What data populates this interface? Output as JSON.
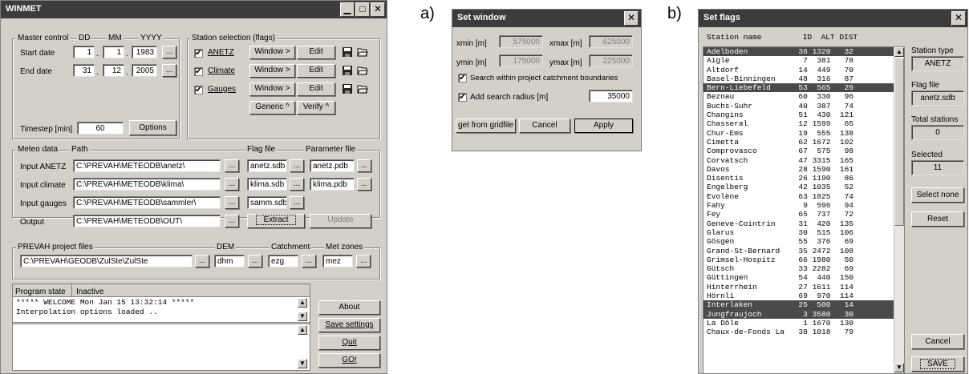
{
  "winmet": {
    "title": "WINMET",
    "master": {
      "group_label": "Master control",
      "dd": "DD",
      "mm": "MM",
      "yyyy": "YYYY",
      "start_label": "Start date",
      "start_dd": "1",
      "start_mm": "1",
      "start_yyyy": "1983",
      "end_label": "End date",
      "end_dd": "31",
      "end_mm": "12",
      "end_yyyy": "2005",
      "timestep_label": "Timestep [min]",
      "timestep": "60",
      "options": "Options",
      "dot": ".",
      "dots": "..."
    },
    "stations": {
      "group_label": "Station selection (flags)",
      "rows": [
        {
          "check": "✔",
          "label": "ANETZ",
          "window": "Window >",
          "edit": "Edit"
        },
        {
          "check": "✔",
          "label": "Climate",
          "window": "Window >",
          "edit": "Edit"
        },
        {
          "check": "✔",
          "label": "Gauges",
          "window": "Window >",
          "edit": "Edit"
        }
      ],
      "generic": "Generic ^",
      "verify": "Verify ^"
    },
    "meteo": {
      "group_label": "Meteo data",
      "path_label": "Path",
      "flag_label": "Flag file",
      "param_label": "Parameter file",
      "rows": [
        {
          "label": "Input ANETZ",
          "path": "C:\\PREVAH\\METEODB\\anetz\\",
          "flag": "anetz.sdb",
          "param": "anetz.pdb"
        },
        {
          "label": "Input climate",
          "path": "C:\\PREVAH\\METEODB\\klima\\",
          "flag": "klima.sdb",
          "param": "klima.pdb"
        },
        {
          "label": "Input gauges",
          "path": "C:\\PREVAH\\METEODB\\sammler\\",
          "flag": "samm.sdb",
          "param": ""
        },
        {
          "label": "Output",
          "path": "C:\\PREVAH\\METEODB\\OUT\\",
          "flag": "",
          "param": ""
        }
      ],
      "extract": "Extract",
      "update": "Update"
    },
    "prevah": {
      "group_label": "PREVAH project files",
      "path": "C:\\PREVAH\\GEODB\\ZulSte\\ZulSte",
      "dem_label": "DEM",
      "dem": "dhm",
      "catch_label": "Catchment",
      "catch": "ezg",
      "met_label": "Met zones",
      "met": "mez"
    },
    "state": {
      "label": "Program state",
      "value": "Inactive",
      "log1": "***** WELCOME Mon Jan 15 13:32:14 *****",
      "log2": "Interpolation options loaded .."
    },
    "buttons": {
      "about": "About",
      "save": "Save settings",
      "quit": "Quit",
      "go": "GO!"
    }
  },
  "tags": {
    "a": "a)",
    "b": "b)"
  },
  "set_window": {
    "title": "Set window",
    "xmin_label": "xmin [m]",
    "xmin": "575000",
    "xmax_label": "xmax [m]",
    "xmax": "625000",
    "ymin_label": "ymin [m]",
    "ymin": "175000",
    "ymax_label": "ymax [m]",
    "ymax": "225000",
    "search_label": "Search within project catchment boundaries",
    "radius_label": "Add search radius [m]",
    "radius": "35000",
    "gridfile": "get from gridfile",
    "cancel": "Cancel",
    "apply": "Apply"
  },
  "set_flags": {
    "title": "Set flags",
    "header": "Station name         ID  ALT DIST",
    "stations": [
      {
        "name": "Adelboden",
        "id": "36",
        "alt": "1320",
        "dist": "32",
        "selected": true
      },
      {
        "name": "Aigle",
        "id": "7",
        "alt": "381",
        "dist": "78",
        "selected": false
      },
      {
        "name": "Altdorf",
        "id": "14",
        "alt": "449",
        "dist": "70",
        "selected": false
      },
      {
        "name": "Basel-Binningen",
        "id": "48",
        "alt": "316",
        "dist": "87",
        "selected": false
      },
      {
        "name": "Bern-Liebefeld",
        "id": "53",
        "alt": "565",
        "dist": "29",
        "selected": true
      },
      {
        "name": "Beznau",
        "id": "60",
        "alt": "330",
        "dist": "96",
        "selected": false
      },
      {
        "name": "Buchs-Suhr",
        "id": "40",
        "alt": "387",
        "dist": "74",
        "selected": false
      },
      {
        "name": "Changins",
        "id": "51",
        "alt": "430",
        "dist": "121",
        "selected": false
      },
      {
        "name": "Chasseral",
        "id": "12",
        "alt": "1599",
        "dist": "65",
        "selected": false
      },
      {
        "name": "Chur-Ems",
        "id": "19",
        "alt": "555",
        "dist": "138",
        "selected": false
      },
      {
        "name": "Cimetta",
        "id": "62",
        "alt": "1672",
        "dist": "102",
        "selected": false
      },
      {
        "name": "Comprovasco",
        "id": "67",
        "alt": "575",
        "dist": "98",
        "selected": false
      },
      {
        "name": "Corvatsch",
        "id": "47",
        "alt": "3315",
        "dist": "165",
        "selected": false
      },
      {
        "name": "Davos",
        "id": "28",
        "alt": "1590",
        "dist": "161",
        "selected": false
      },
      {
        "name": "Disentis",
        "id": "26",
        "alt": "1190",
        "dist": "86",
        "selected": false
      },
      {
        "name": "Engelberg",
        "id": "42",
        "alt": "1035",
        "dist": "52",
        "selected": false
      },
      {
        "name": "Evolène",
        "id": "63",
        "alt": "1825",
        "dist": "74",
        "selected": false
      },
      {
        "name": "Fahy",
        "id": "9",
        "alt": "596",
        "dist": "94",
        "selected": false
      },
      {
        "name": "Fey",
        "id": "65",
        "alt": "737",
        "dist": "72",
        "selected": false
      },
      {
        "name": "Geneve-Cointrin",
        "id": "31",
        "alt": "420",
        "dist": "135",
        "selected": false
      },
      {
        "name": "Glarus",
        "id": "30",
        "alt": "515",
        "dist": "106",
        "selected": false
      },
      {
        "name": "Gösgen",
        "id": "55",
        "alt": "376",
        "dist": "69",
        "selected": false
      },
      {
        "name": "Grand-St-Bernard",
        "id": "35",
        "alt": "2472",
        "dist": "108",
        "selected": false
      },
      {
        "name": "Grimsel-Hospitz",
        "id": "66",
        "alt": "1980",
        "dist": "50",
        "selected": false
      },
      {
        "name": "Gütsch",
        "id": "33",
        "alt": "2282",
        "dist": "69",
        "selected": false
      },
      {
        "name": "Güttingen",
        "id": "54",
        "alt": "440",
        "dist": "150",
        "selected": false
      },
      {
        "name": "Hinterrhein",
        "id": "27",
        "alt": "1611",
        "dist": "114",
        "selected": false
      },
      {
        "name": "Hörnli",
        "id": "69",
        "alt": "970",
        "dist": "114",
        "selected": false
      },
      {
        "name": "Interlaken",
        "id": "25",
        "alt": "580",
        "dist": "14",
        "selected": true
      },
      {
        "name": "Jungfraujoch",
        "id": "3",
        "alt": "3580",
        "dist": "30",
        "selected": true
      },
      {
        "name": "La Dôle",
        "id": "1",
        "alt": "1670",
        "dist": "130",
        "selected": false
      },
      {
        "name": "Chaux-de-Fonds La",
        "id": "38",
        "alt": "1018",
        "dist": "79",
        "selected": false
      }
    ],
    "type_label": "Station type",
    "type": "ANETZ",
    "flag_label": "Flag file",
    "flag": "anetz.sdb",
    "total_label": "Total stations",
    "total": "0",
    "selected_label": "Selected",
    "selected": "11",
    "select_none": "Select none",
    "reset": "Reset",
    "cancel": "Cancel",
    "save": "SAVE"
  }
}
